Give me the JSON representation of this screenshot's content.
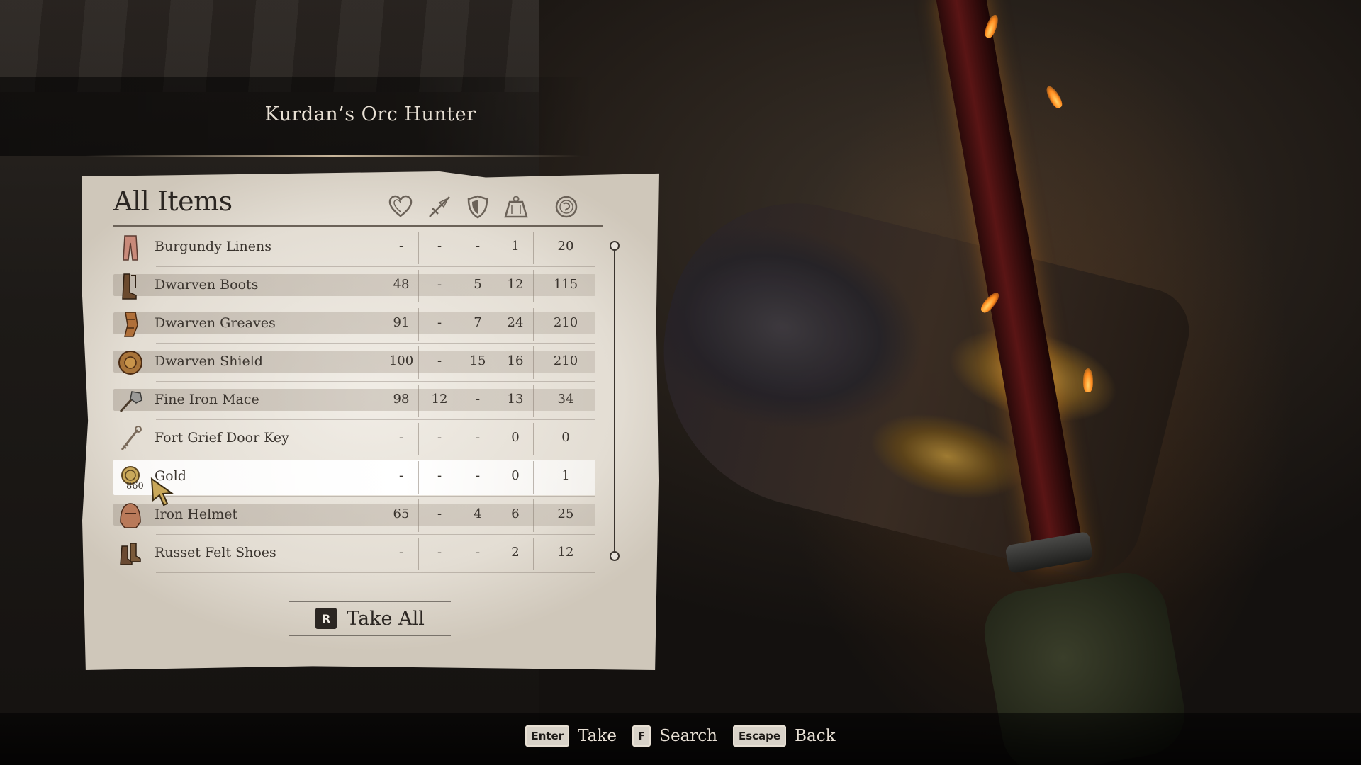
{
  "container": {
    "title": "Kurdan’s Orc Hunter"
  },
  "panel": {
    "heading": "All Items",
    "columns": [
      {
        "name": "health",
        "icon": "heart-icon"
      },
      {
        "name": "damage",
        "icon": "sword-icon"
      },
      {
        "name": "armor",
        "icon": "shield-icon"
      },
      {
        "name": "weight",
        "icon": "weight-icon"
      },
      {
        "name": "value",
        "icon": "coin-icon"
      }
    ],
    "items": [
      {
        "name": "Burgundy Linens",
        "icon": "pants-icon",
        "hp": "-",
        "dmg": "-",
        "arm": "-",
        "wt": "1",
        "val": "20",
        "style": "plain"
      },
      {
        "name": "Dwarven Boots",
        "icon": "boots-icon",
        "hp": "48",
        "dmg": "-",
        "arm": "5",
        "wt": "12",
        "val": "115",
        "style": "shaded"
      },
      {
        "name": "Dwarven Greaves",
        "icon": "greaves-icon",
        "hp": "91",
        "dmg": "-",
        "arm": "7",
        "wt": "24",
        "val": "210",
        "style": "shaded"
      },
      {
        "name": "Dwarven Shield",
        "icon": "shield-item-icon",
        "hp": "100",
        "dmg": "-",
        "arm": "15",
        "wt": "16",
        "val": "210",
        "style": "shaded"
      },
      {
        "name": "Fine Iron Mace",
        "icon": "mace-icon",
        "hp": "98",
        "dmg": "12",
        "arm": "-",
        "wt": "13",
        "val": "34",
        "style": "shaded"
      },
      {
        "name": "Fort Grief Door Key",
        "icon": "key-icon",
        "hp": "-",
        "dmg": "-",
        "arm": "-",
        "wt": "0",
        "val": "0",
        "style": "plain"
      },
      {
        "name": "Gold",
        "icon": "gold-icon",
        "qty": "860",
        "hp": "-",
        "dmg": "-",
        "arm": "-",
        "wt": "0",
        "val": "1",
        "style": "selected"
      },
      {
        "name": "Iron Helmet",
        "icon": "helmet-icon",
        "hp": "65",
        "dmg": "-",
        "arm": "4",
        "wt": "6",
        "val": "25",
        "style": "shaded"
      },
      {
        "name": "Russet Felt Shoes",
        "icon": "shoes-icon",
        "hp": "-",
        "dmg": "-",
        "arm": "-",
        "wt": "2",
        "val": "12",
        "style": "plain"
      }
    ],
    "take_all": {
      "key": "R",
      "label": "Take All"
    }
  },
  "hints": [
    {
      "key": "Enter",
      "label": "Take"
    },
    {
      "key": "F",
      "label": "Search"
    },
    {
      "key": "Escape",
      "label": "Back"
    }
  ],
  "colors": {
    "parchment": "#e9e4dc",
    "ink": "#2b2622",
    "text_light": "#e8e0d4"
  }
}
